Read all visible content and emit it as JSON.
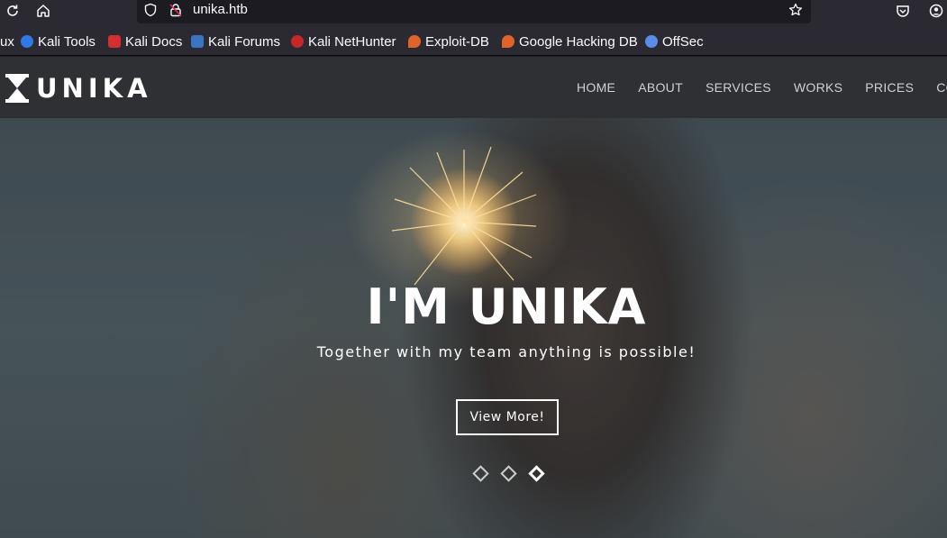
{
  "browser": {
    "url": "unika.htb",
    "bookmarks": [
      {
        "label": "ux",
        "icon": "kali-icon",
        "color": "#1e88e5"
      },
      {
        "label": "Kali Tools",
        "icon": "kali-tools-icon",
        "color": "#2f7ae5"
      },
      {
        "label": "Kali Docs",
        "icon": "kali-docs-icon",
        "color": "#d32f2f"
      },
      {
        "label": "Kali Forums",
        "icon": "kali-forums-icon",
        "color": "#3a75c4"
      },
      {
        "label": "Kali NetHunter",
        "icon": "nethunter-icon",
        "color": "#c62828"
      },
      {
        "label": "Exploit-DB",
        "icon": "exploitdb-icon",
        "color": "#e0632a"
      },
      {
        "label": "Google Hacking DB",
        "icon": "ghdb-icon",
        "color": "#e0632a"
      },
      {
        "label": "OffSec",
        "icon": "offsec-icon",
        "color": "#5b8de8"
      }
    ]
  },
  "site": {
    "logo_text": "UNIKA",
    "nav": [
      "HOME",
      "ABOUT",
      "SERVICES",
      "WORKS",
      "PRICES",
      "CONTA"
    ]
  },
  "hero": {
    "title": "I'M UNIKA",
    "subtitle": "Together with my team anything is possible!",
    "button": "View More!",
    "slides_total": 3,
    "slide_active": 3
  }
}
